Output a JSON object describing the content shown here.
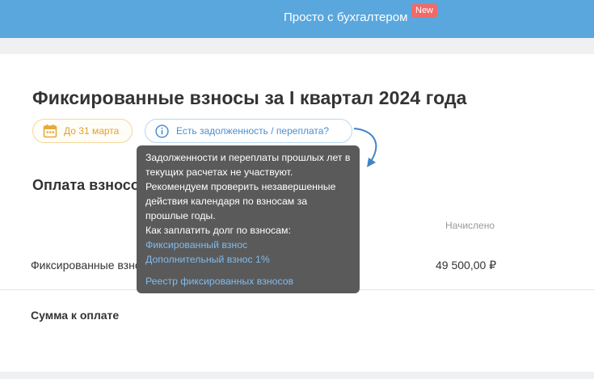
{
  "topbar": {
    "link_label": "Просто с бухгалтером",
    "badge": "New"
  },
  "page": {
    "title": "Фиксированные взносы за I квартал 2024 года",
    "deadline_chip": "До 31 марта",
    "debt_chip": "Есть задолженность / переплата?",
    "section_title": "Оплата взносов",
    "column_header": "Начислено",
    "row_label": "Фиксированные взносы",
    "row_value": "49 500,00 ₽",
    "total_label": "Сумма к оплате"
  },
  "tooltip": {
    "text": "Задолженности и переплаты прошлых лет в текущих расчетах не участвуют. Рекомендуем проверить незавершенные действия календаря по взносам за прошлые годы.",
    "how_to": "Как заплатить долг по взносам:",
    "link_fixed": "Фиксированный взнос",
    "link_additional": "Дополнительный взнос 1%",
    "link_registry": "Реестр фиксированных взносов"
  },
  "colors": {
    "topbar": "#5aa7de",
    "badge": "#f06a6a",
    "deadline": "#e4a22a",
    "link": "#4a8fcf",
    "tooltip_bg": "#5a5a5a",
    "tooltip_link": "#7fbcf0"
  }
}
